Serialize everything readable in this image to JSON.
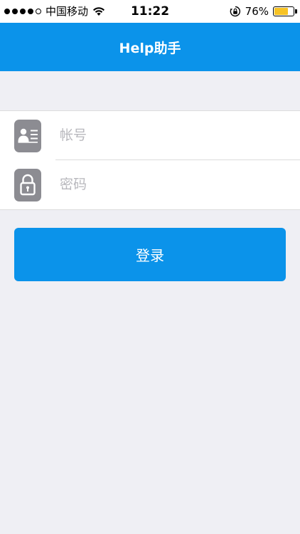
{
  "status_bar": {
    "carrier": "中国移动",
    "time": "11:22",
    "battery_percent_label": "76%",
    "battery_level": 0.76,
    "icons": [
      "signal-dots",
      "wifi-icon",
      "rotation-lock-icon",
      "battery-icon"
    ]
  },
  "nav": {
    "title": "Help助手"
  },
  "form": {
    "account_placeholder": "帐号",
    "account_value": "",
    "account_icon": "id-card-icon",
    "password_placeholder": "密码",
    "password_value": "",
    "password_icon": "lock-icon"
  },
  "login_button": {
    "label": "登录"
  },
  "colors": {
    "accent": "#0b93ea",
    "background": "#efeff4",
    "icon_gray": "#8c8c92",
    "battery": "#f7c325"
  }
}
